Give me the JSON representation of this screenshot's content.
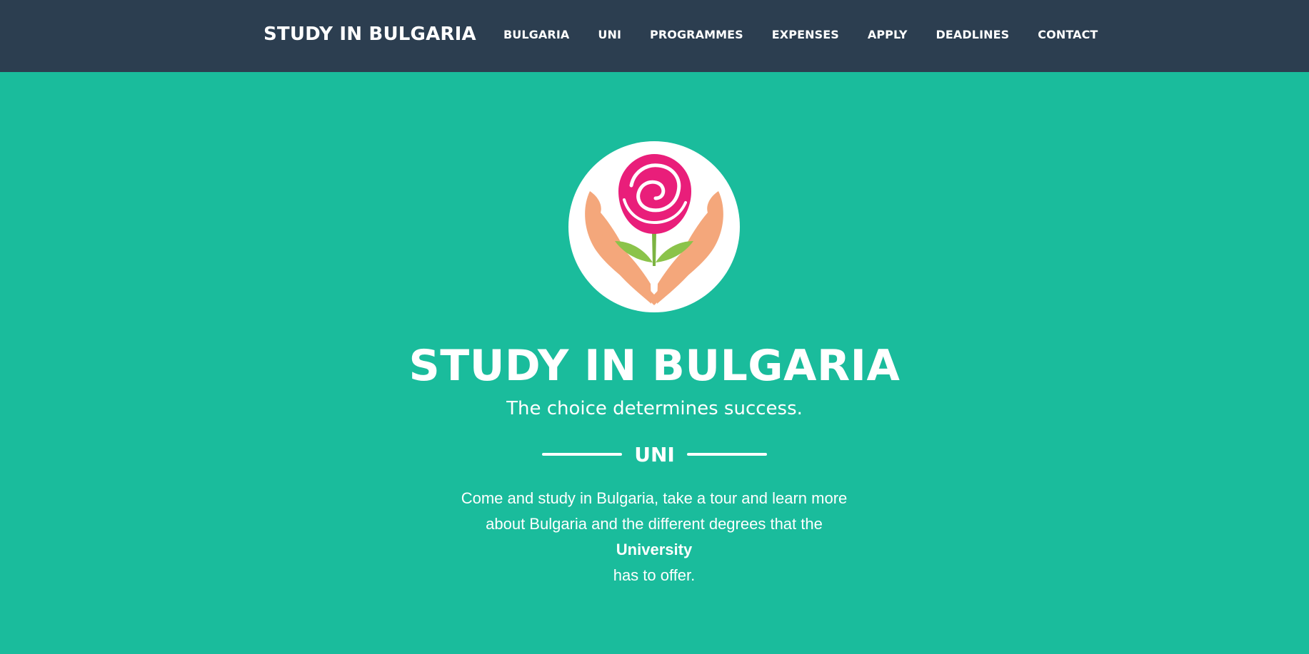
{
  "navbar": {
    "brand": "STUDY IN BULGARIA",
    "links": [
      "BULGARIA",
      "UNI",
      "PROGRAMMES",
      "EXPENSES",
      "APPLY",
      "DEADLINES",
      "CONTACT"
    ]
  },
  "hero": {
    "logo_icon": "rose-in-hands-logo",
    "title": "STUDY IN BULGARIA",
    "subtitle": "The choice determines success.",
    "divider_label": "UNI",
    "text_line1": "Come and study in Bulgaria, take a tour and learn more about Bulgaria and the different degrees that the",
    "text_bold": "University",
    "text_line2": "has to offer."
  },
  "colors": {
    "navbar_bg": "#2c3e50",
    "hero_bg": "#1abc9c",
    "rose": "#e91e7a",
    "leaf": "#8bc34a",
    "hands": "#f4a77b"
  }
}
